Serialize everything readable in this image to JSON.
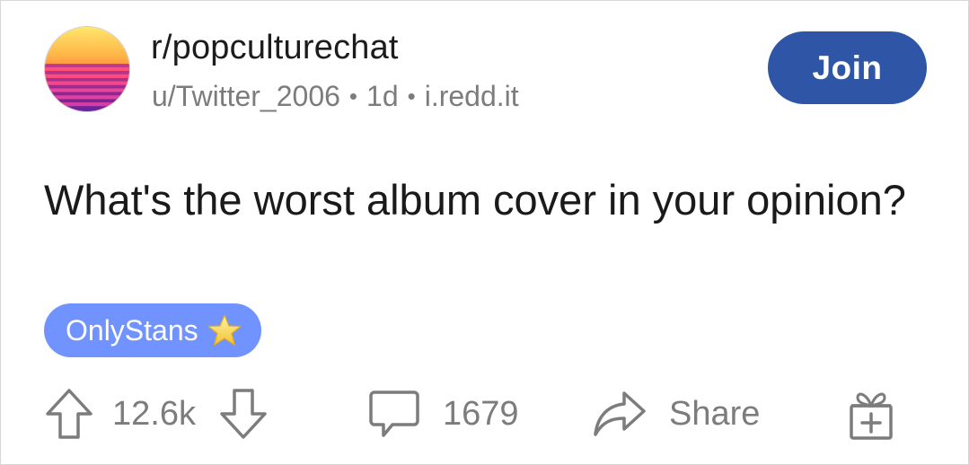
{
  "post": {
    "subreddit": "r/popculturechat",
    "author": "u/Twitter_2006",
    "age": "1d",
    "domain": "i.redd.it",
    "separator": "•",
    "join_label": "Join",
    "title": "What's the worst album cover in your opinion?",
    "flair": {
      "text": "OnlyStans",
      "icon": "star-icon",
      "color": "#7193ff"
    }
  },
  "actions": {
    "score": "12.6k",
    "comments": "1679",
    "share_label": "Share",
    "icons": [
      "upvote-arrow-icon",
      "downvote-arrow-icon",
      "comment-bubble-icon",
      "share-arrow-icon",
      "gift-box-icon"
    ]
  },
  "colors": {
    "join_button": "#2f56a6",
    "text_primary": "#1a1a1b",
    "text_muted": "#7c7c7c"
  }
}
